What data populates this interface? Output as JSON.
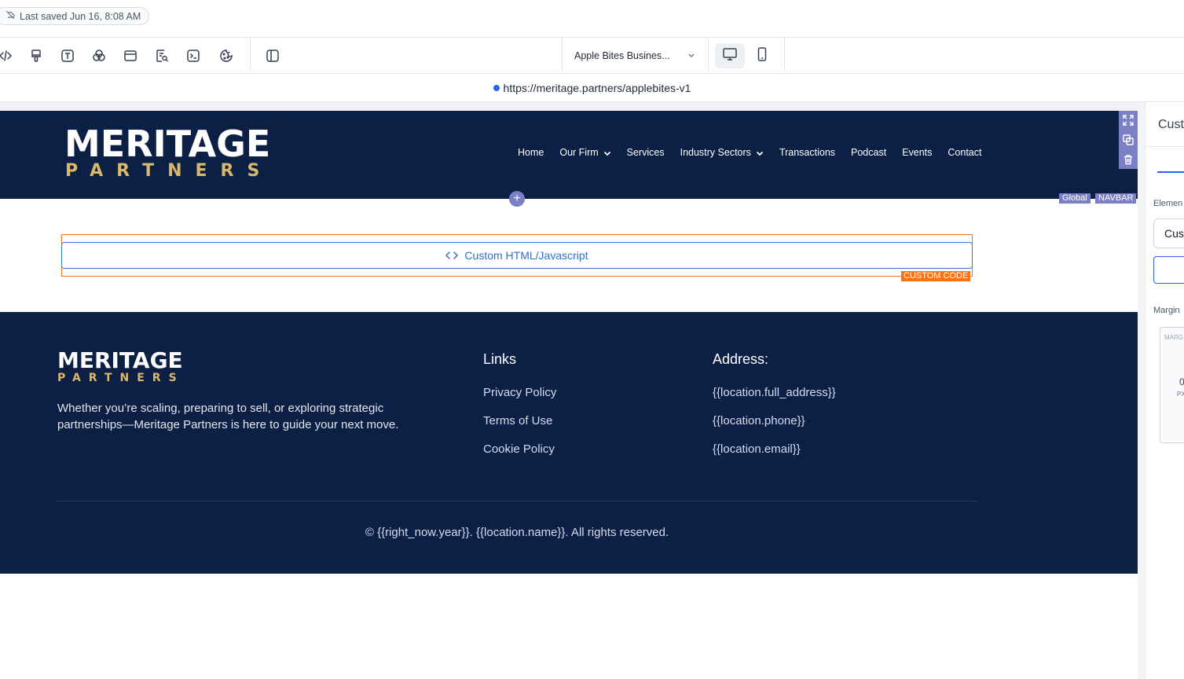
{
  "topbar": {
    "saved_text": "Last saved Jun 16, 8:08 AM"
  },
  "toolbar": {
    "page_name": "Apple Bites Busines...",
    "tools": [
      "code-icon",
      "paint-brush-icon",
      "text-icon",
      "shapes-icon",
      "layout-icon",
      "form-icon",
      "terminal-icon",
      "cookie-icon",
      "split-view-icon"
    ],
    "devices": [
      "desktop-icon",
      "mobile-icon"
    ]
  },
  "url": {
    "address": "https://meritage.partners/applebites-v1"
  },
  "navbar": {
    "logo_top": "MERITAGE",
    "logo_bottom": "PARTNERS",
    "links": [
      "Home",
      "Our Firm",
      "Services",
      "Industry Sectors",
      "Transactions",
      "Podcast",
      "Events",
      "Contact"
    ],
    "tag_global": "Global",
    "tag_navbar": "NAVBAR"
  },
  "custom_code": {
    "label": "Custom HTML/Javascript",
    "tag": "CUSTOM CODE"
  },
  "footer": {
    "logo_top": "MERITAGE",
    "logo_bottom": "PARTNERS",
    "description": "Whether you’re scaling, preparing to sell, or exploring strategic partnerships—Meritage Partners is here to guide your next move.",
    "links_heading": "Links",
    "links": [
      "Privacy Policy",
      "Terms of Use",
      "Cookie Policy"
    ],
    "address_heading": "Address:",
    "address_lines": [
      "{{location.full_address}}",
      "{{location.phone}}",
      "{{location.email}}"
    ],
    "copyright": "© {{right_now.year}}. {{location.name}}. All rights reserved."
  },
  "right_panel": {
    "title": "Cust",
    "element_label": "Elemen",
    "element_value": "Cus",
    "margin_label": "Margin",
    "margin_box_label": "MARG",
    "margin_value": "0",
    "margin_unit": "PX"
  },
  "colors": {
    "navy": "#0c1f45",
    "gold": "#d9b86c",
    "accent": "#7b7fc4",
    "orange": "#f97316",
    "link_blue": "#2f6fd0"
  }
}
